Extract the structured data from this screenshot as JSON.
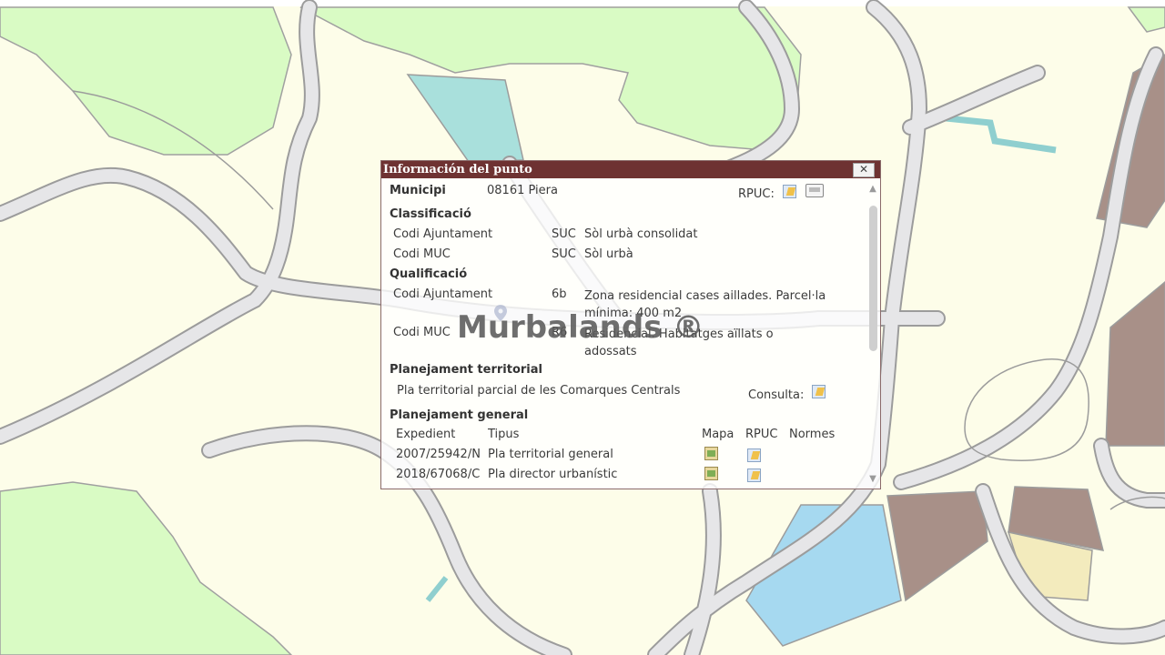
{
  "popup": {
    "title": "Información del punto",
    "close_glyph": "✕",
    "municipi_label": "Municipi",
    "municipi_value": "08161 Piera",
    "rpuc_label": "RPUC:",
    "rpuc_icon": "document-link-icon",
    "print_icon": "printer-icon",
    "classificacio": {
      "heading": "Classificació",
      "rows": [
        {
          "label": "Codi Ajuntament",
          "code": "SUC",
          "desc": "Sòl urbà consolidat"
        },
        {
          "label": "Codi MUC",
          "code": "SUC",
          "desc": "Sòl urbà"
        }
      ]
    },
    "qualificacio": {
      "heading": "Qualificació",
      "rows": [
        {
          "label": "Codi Ajuntament",
          "code": "6b",
          "desc": "Zona residencial cases aillades. Parcel·la mínima: 400 m2"
        },
        {
          "label": "Codi MUC",
          "code": "R6",
          "desc": "Residencial. Habitatges aïllats o adossats"
        }
      ]
    },
    "planejament_territorial": {
      "heading": "Planejament territorial",
      "plan": "Pla territorial parcial de les Comarques Centrals",
      "consulta_label": "Consulta:"
    },
    "planejament_general": {
      "heading": "Planejament general",
      "columns": [
        "Expedient",
        "Tipus",
        "Mapa",
        "RPUC",
        "Normes"
      ],
      "rows": [
        {
          "expedient": "2007/25942/N",
          "tipus": "Pla territorial general"
        },
        {
          "expedient": "2018/67068/C",
          "tipus": "Pla director urbanístic"
        }
      ]
    }
  },
  "watermark": "Murbalands ®",
  "map_colors": {
    "residential": "#fdfde9",
    "green": "#d9fbc4",
    "road": "#e6e6e8",
    "road_edge": "#9c9c9c",
    "water_channel": "#a9e0dc",
    "pond": "#a6d9f0",
    "built": "#a89088",
    "sand": "#f3ebbd"
  }
}
